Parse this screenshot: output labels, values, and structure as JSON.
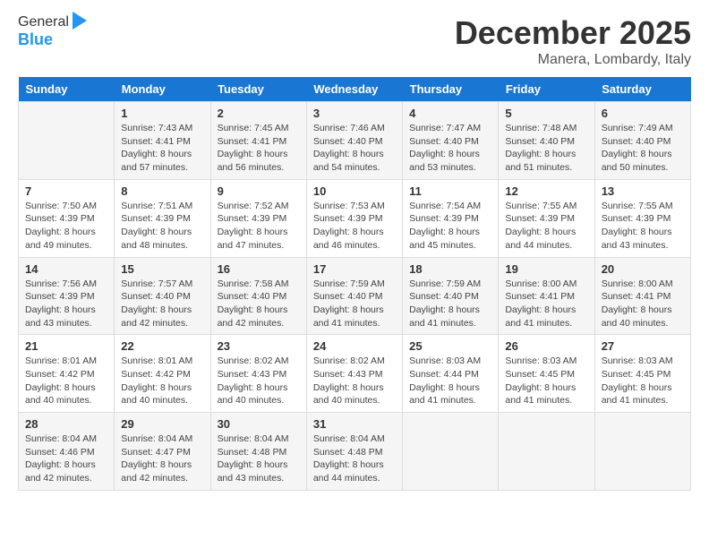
{
  "header": {
    "logo_line1": "General",
    "logo_line2": "Blue",
    "month_title": "December 2025",
    "location": "Manera, Lombardy, Italy"
  },
  "days_of_week": [
    "Sunday",
    "Monday",
    "Tuesday",
    "Wednesday",
    "Thursday",
    "Friday",
    "Saturday"
  ],
  "weeks": [
    [
      {
        "day": "",
        "info": ""
      },
      {
        "day": "1",
        "info": "Sunrise: 7:43 AM\nSunset: 4:41 PM\nDaylight: 8 hours\nand 57 minutes."
      },
      {
        "day": "2",
        "info": "Sunrise: 7:45 AM\nSunset: 4:41 PM\nDaylight: 8 hours\nand 56 minutes."
      },
      {
        "day": "3",
        "info": "Sunrise: 7:46 AM\nSunset: 4:40 PM\nDaylight: 8 hours\nand 54 minutes."
      },
      {
        "day": "4",
        "info": "Sunrise: 7:47 AM\nSunset: 4:40 PM\nDaylight: 8 hours\nand 53 minutes."
      },
      {
        "day": "5",
        "info": "Sunrise: 7:48 AM\nSunset: 4:40 PM\nDaylight: 8 hours\nand 51 minutes."
      },
      {
        "day": "6",
        "info": "Sunrise: 7:49 AM\nSunset: 4:40 PM\nDaylight: 8 hours\nand 50 minutes."
      }
    ],
    [
      {
        "day": "7",
        "info": "Sunrise: 7:50 AM\nSunset: 4:39 PM\nDaylight: 8 hours\nand 49 minutes."
      },
      {
        "day": "8",
        "info": "Sunrise: 7:51 AM\nSunset: 4:39 PM\nDaylight: 8 hours\nand 48 minutes."
      },
      {
        "day": "9",
        "info": "Sunrise: 7:52 AM\nSunset: 4:39 PM\nDaylight: 8 hours\nand 47 minutes."
      },
      {
        "day": "10",
        "info": "Sunrise: 7:53 AM\nSunset: 4:39 PM\nDaylight: 8 hours\nand 46 minutes."
      },
      {
        "day": "11",
        "info": "Sunrise: 7:54 AM\nSunset: 4:39 PM\nDaylight: 8 hours\nand 45 minutes."
      },
      {
        "day": "12",
        "info": "Sunrise: 7:55 AM\nSunset: 4:39 PM\nDaylight: 8 hours\nand 44 minutes."
      },
      {
        "day": "13",
        "info": "Sunrise: 7:55 AM\nSunset: 4:39 PM\nDaylight: 8 hours\nand 43 minutes."
      }
    ],
    [
      {
        "day": "14",
        "info": "Sunrise: 7:56 AM\nSunset: 4:39 PM\nDaylight: 8 hours\nand 43 minutes."
      },
      {
        "day": "15",
        "info": "Sunrise: 7:57 AM\nSunset: 4:40 PM\nDaylight: 8 hours\nand 42 minutes."
      },
      {
        "day": "16",
        "info": "Sunrise: 7:58 AM\nSunset: 4:40 PM\nDaylight: 8 hours\nand 42 minutes."
      },
      {
        "day": "17",
        "info": "Sunrise: 7:59 AM\nSunset: 4:40 PM\nDaylight: 8 hours\nand 41 minutes."
      },
      {
        "day": "18",
        "info": "Sunrise: 7:59 AM\nSunset: 4:40 PM\nDaylight: 8 hours\nand 41 minutes."
      },
      {
        "day": "19",
        "info": "Sunrise: 8:00 AM\nSunset: 4:41 PM\nDaylight: 8 hours\nand 41 minutes."
      },
      {
        "day": "20",
        "info": "Sunrise: 8:00 AM\nSunset: 4:41 PM\nDaylight: 8 hours\nand 40 minutes."
      }
    ],
    [
      {
        "day": "21",
        "info": "Sunrise: 8:01 AM\nSunset: 4:42 PM\nDaylight: 8 hours\nand 40 minutes."
      },
      {
        "day": "22",
        "info": "Sunrise: 8:01 AM\nSunset: 4:42 PM\nDaylight: 8 hours\nand 40 minutes."
      },
      {
        "day": "23",
        "info": "Sunrise: 8:02 AM\nSunset: 4:43 PM\nDaylight: 8 hours\nand 40 minutes."
      },
      {
        "day": "24",
        "info": "Sunrise: 8:02 AM\nSunset: 4:43 PM\nDaylight: 8 hours\nand 40 minutes."
      },
      {
        "day": "25",
        "info": "Sunrise: 8:03 AM\nSunset: 4:44 PM\nDaylight: 8 hours\nand 41 minutes."
      },
      {
        "day": "26",
        "info": "Sunrise: 8:03 AM\nSunset: 4:45 PM\nDaylight: 8 hours\nand 41 minutes."
      },
      {
        "day": "27",
        "info": "Sunrise: 8:03 AM\nSunset: 4:45 PM\nDaylight: 8 hours\nand 41 minutes."
      }
    ],
    [
      {
        "day": "28",
        "info": "Sunrise: 8:04 AM\nSunset: 4:46 PM\nDaylight: 8 hours\nand 42 minutes."
      },
      {
        "day": "29",
        "info": "Sunrise: 8:04 AM\nSunset: 4:47 PM\nDaylight: 8 hours\nand 42 minutes."
      },
      {
        "day": "30",
        "info": "Sunrise: 8:04 AM\nSunset: 4:48 PM\nDaylight: 8 hours\nand 43 minutes."
      },
      {
        "day": "31",
        "info": "Sunrise: 8:04 AM\nSunset: 4:48 PM\nDaylight: 8 hours\nand 44 minutes."
      },
      {
        "day": "",
        "info": ""
      },
      {
        "day": "",
        "info": ""
      },
      {
        "day": "",
        "info": ""
      }
    ]
  ]
}
